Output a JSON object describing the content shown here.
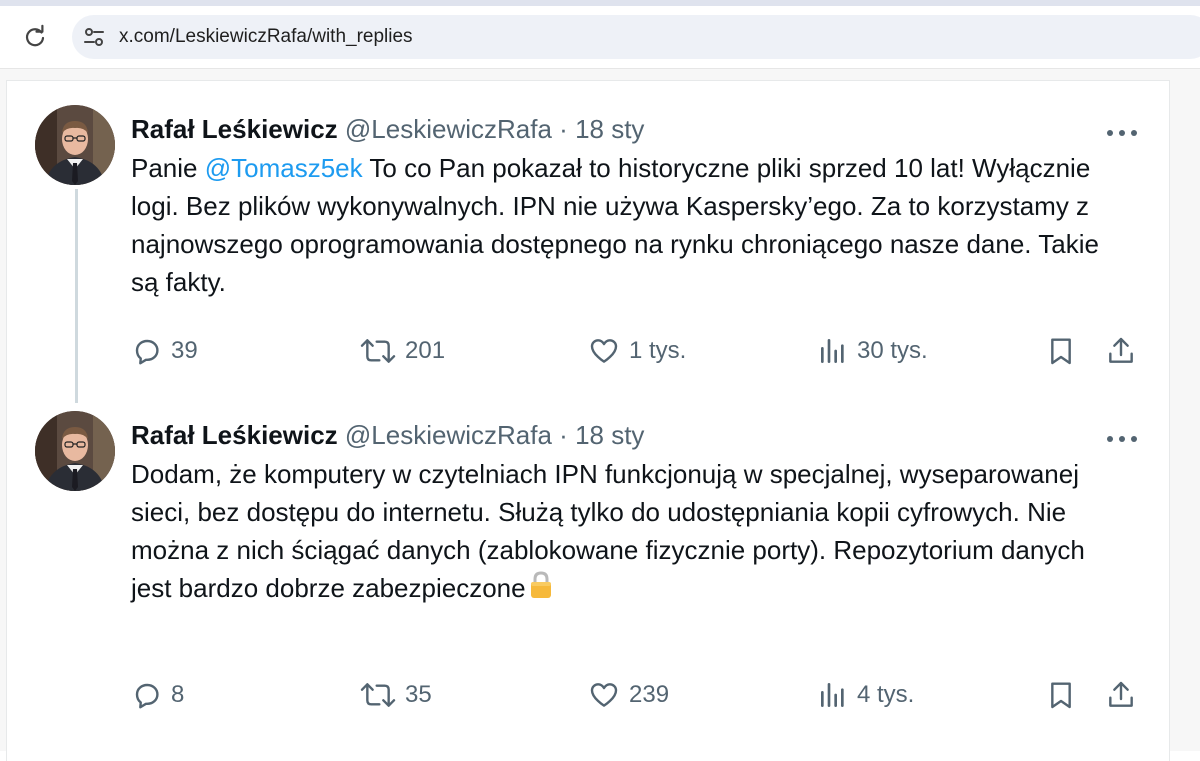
{
  "browser": {
    "url": "x.com/LeskiewiczRafa/with_replies"
  },
  "tweets": [
    {
      "author": {
        "name": "Rafał Leśkiewicz",
        "handle": "@LeskiewiczRafa"
      },
      "separator": "·",
      "date": "18 sty",
      "text_prefix": "Panie ",
      "mention": "@Tomasz5ek",
      "text": " To co Pan pokazał to historyczne pliki sprzed 10 lat! Wyłącznie logi. Bez plików wykonywalnych. IPN nie używa Kaspersky’ego. Za to korzystamy z najnowszego oprogramowania dostępnego na rynku chroniącego nasze dane. Takie są fakty.",
      "stats": {
        "replies": "39",
        "reposts": "201",
        "likes": "1 tys.",
        "views": "30 tys."
      }
    },
    {
      "author": {
        "name": "Rafał Leśkiewicz",
        "handle": "@LeskiewiczRafa"
      },
      "separator": "·",
      "date": "18 sty",
      "text": "Dodam, że komputery w czytelniach IPN funkcjonują w specjalnej, wyseparowanej sieci, bez dostępu do internetu. Służą tylko do udostępniania kopii cyfrowych. Nie można z nich ściągać danych (zablokowane fizycznie porty). Repozytorium danych jest bardzo dobrze zabezpieczone",
      "emoji": "lock-icon",
      "stats": {
        "replies": "8",
        "reposts": "35",
        "likes": "239",
        "views": "4 tys."
      }
    }
  ],
  "colors": {
    "text": "#0f1419",
    "secondary": "#536471",
    "link": "#1d9bf0",
    "thread_line": "#cfd9de"
  }
}
